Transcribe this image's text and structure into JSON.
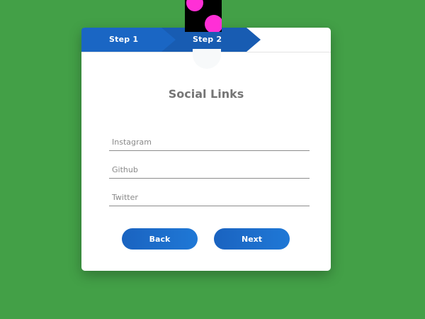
{
  "steps": [
    {
      "label": "Step 1",
      "state": "completed"
    },
    {
      "label": "Step 2",
      "state": "active"
    }
  ],
  "form": {
    "title": "Social Links",
    "fields": [
      {
        "name": "instagram",
        "placeholder": "Instagram",
        "value": ""
      },
      {
        "name": "github",
        "placeholder": "Github",
        "value": ""
      },
      {
        "name": "twitter",
        "placeholder": "Twitter",
        "value": ""
      }
    ]
  },
  "buttons": {
    "back_label": "Back",
    "next_label": "Next"
  },
  "colors": {
    "background": "#43a047",
    "card": "#ffffff",
    "accent": "#1a66c4",
    "accent_dark": "#185cb2",
    "decoration_bg": "#000000",
    "decoration_dots": "#ff2fd6"
  }
}
